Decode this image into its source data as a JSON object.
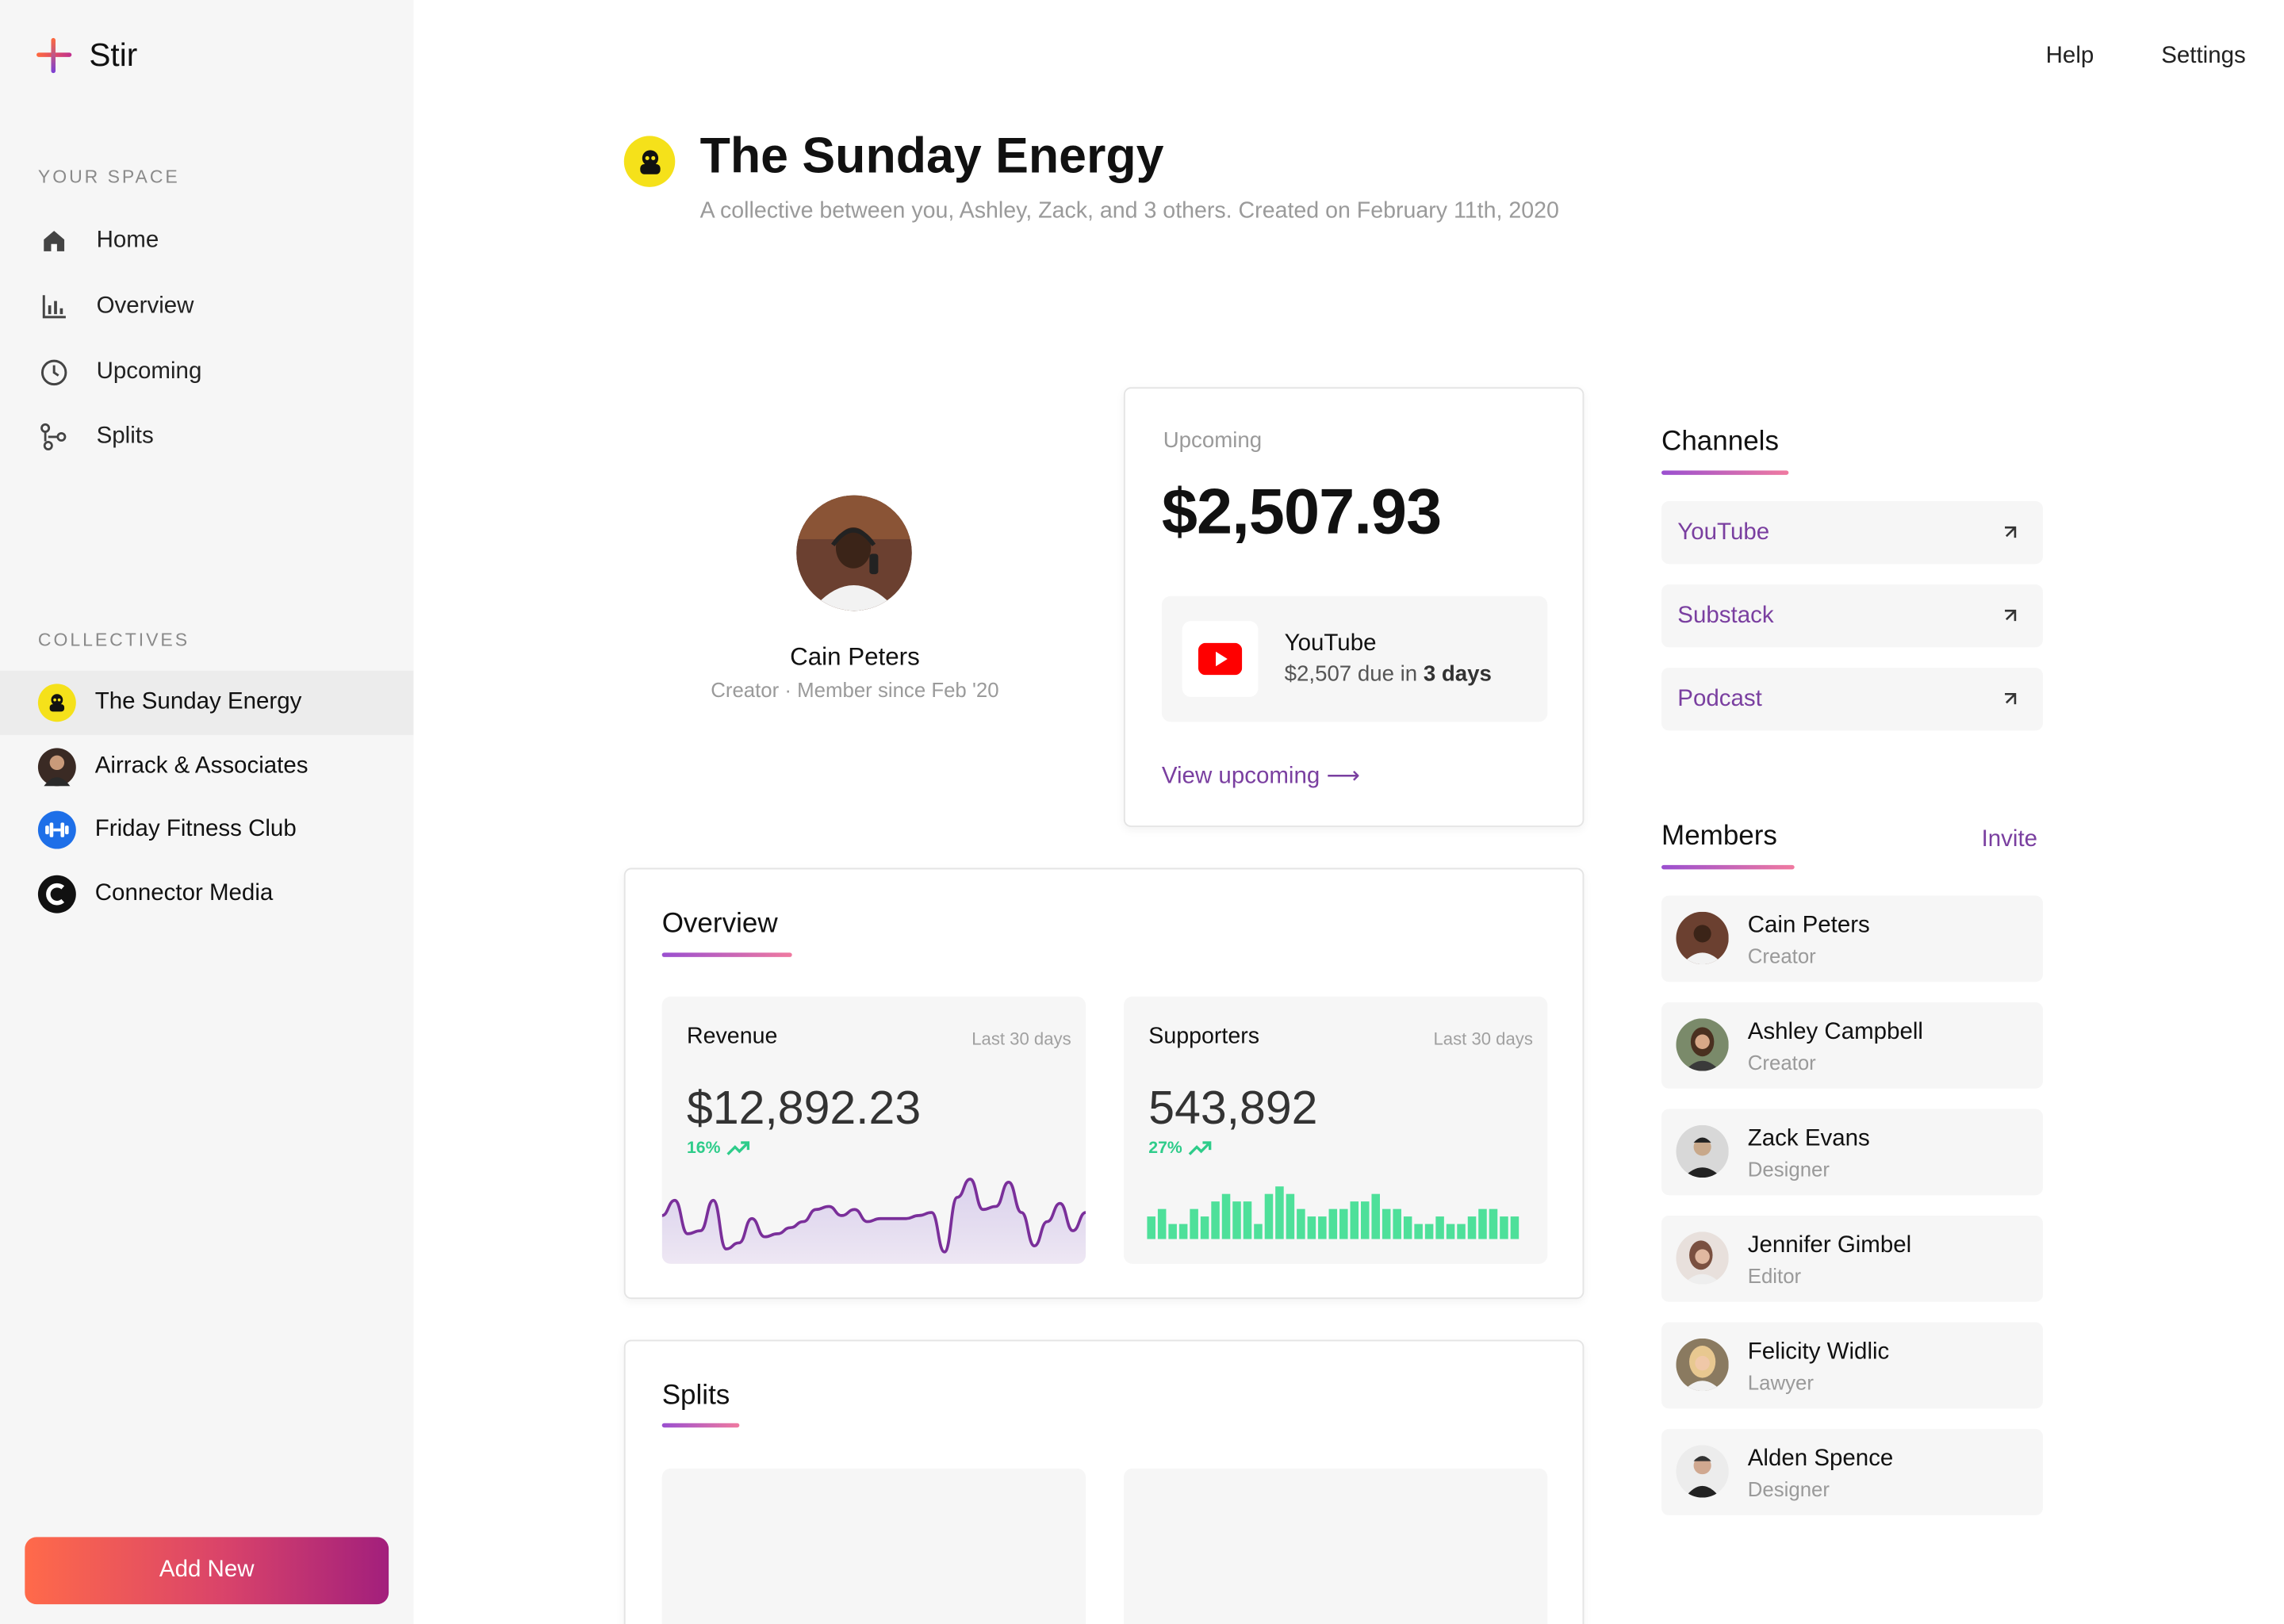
{
  "app": {
    "name": "Stir"
  },
  "topnav": {
    "help": "Help",
    "settings": "Settings"
  },
  "sidebar": {
    "your_space_label": "YOUR SPACE",
    "nav": [
      {
        "label": "Home",
        "icon": "home-icon"
      },
      {
        "label": "Overview",
        "icon": "bar-chart-icon"
      },
      {
        "label": "Upcoming",
        "icon": "clock-icon"
      },
      {
        "label": "Splits",
        "icon": "split-icon"
      }
    ],
    "collectives_label": "COLLECTIVES",
    "collectives": [
      {
        "label": "The Sunday Energy",
        "active": true
      },
      {
        "label": "Airrack & Associates",
        "active": false
      },
      {
        "label": "Friday Fitness Club",
        "active": false
      },
      {
        "label": "Connector Media",
        "active": false
      }
    ],
    "add_new": "Add New"
  },
  "header": {
    "title": "The Sunday Energy",
    "subtitle": "A collective between you, Ashley, Zack, and 3 others. Created on February 11th, 2020"
  },
  "profile": {
    "name": "Cain Peters",
    "subtitle": "Creator · Member since Feb '20"
  },
  "upcoming": {
    "label": "Upcoming",
    "amount": "$2,507.93",
    "item": {
      "title": "YouTube",
      "due_prefix": "$2,507 due in ",
      "due_days": "3 days"
    },
    "link": "View upcoming ⟶"
  },
  "overview": {
    "title": "Overview",
    "revenue": {
      "title": "Revenue",
      "range": "Last 30 days",
      "value": "$12,892.23",
      "change": "16%"
    },
    "supporters": {
      "title": "Supporters",
      "range": "Last 30 days",
      "value": "543,892",
      "change": "27%"
    }
  },
  "splits": {
    "title": "Splits"
  },
  "channels": {
    "title": "Channels",
    "items": [
      {
        "label": "YouTube"
      },
      {
        "label": "Substack"
      },
      {
        "label": "Podcast"
      }
    ]
  },
  "members": {
    "title": "Members",
    "invite": "Invite",
    "items": [
      {
        "name": "Cain Peters",
        "role": "Creator"
      },
      {
        "name": "Ashley Campbell",
        "role": "Creator"
      },
      {
        "name": "Zack Evans",
        "role": "Designer"
      },
      {
        "name": "Jennifer Gimbel",
        "role": "Editor"
      },
      {
        "name": "Felicity Widlic",
        "role": "Lawyer"
      },
      {
        "name": "Alden Spence",
        "role": "Designer"
      }
    ]
  },
  "colors": {
    "accent_purple": "#7a3fa0",
    "positive_green": "#2ecc8a",
    "revenue_line": "#7a2f9a",
    "supporters_bars": "#4ee09a",
    "collective_yellow": "#f5e11a",
    "collective_blue": "#1e6fe8",
    "youtube_red": "#ff0000"
  },
  "chart_data": [
    {
      "type": "area",
      "title": "Revenue",
      "values": [
        14,
        19,
        8,
        9,
        19,
        3,
        5,
        13,
        7,
        8,
        10,
        12,
        16,
        17,
        14,
        16,
        12,
        13,
        13,
        13,
        14,
        15,
        2,
        20,
        26,
        16,
        17,
        25,
        15,
        4,
        12,
        18,
        9,
        15
      ],
      "grid": false
    },
    {
      "type": "bar",
      "title": "Supporters",
      "values": [
        3,
        4,
        2,
        2,
        4,
        3,
        5,
        6,
        5,
        5,
        2,
        6,
        7,
        6,
        4,
        3,
        3,
        4,
        4,
        5,
        5,
        6,
        4,
        4,
        3,
        2,
        2,
        3,
        2,
        2,
        3,
        4,
        4,
        3,
        3
      ],
      "grid": false
    }
  ]
}
